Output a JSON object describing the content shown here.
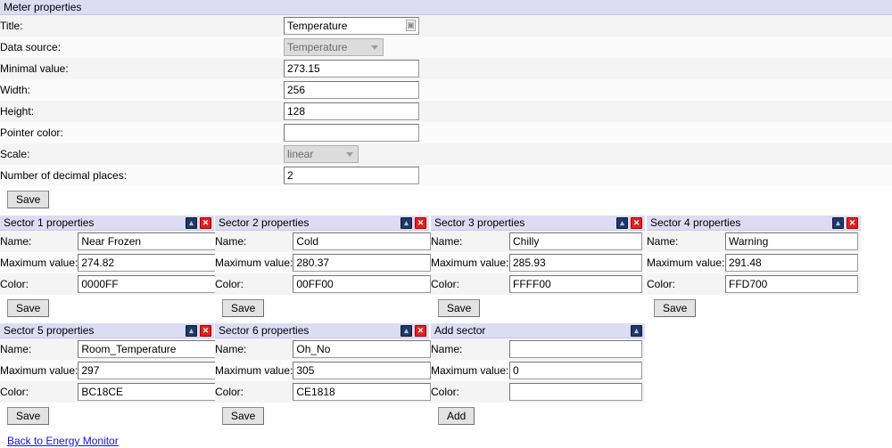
{
  "meter": {
    "header": "Meter properties",
    "rows": [
      {
        "label": "Title:",
        "value": "Temperature",
        "kind": "text-spell"
      },
      {
        "label": "Data source:",
        "value": "Temperature",
        "kind": "select"
      },
      {
        "label": "Minimal value:",
        "value": "273.15",
        "kind": "text"
      },
      {
        "label": "Width:",
        "value": "256",
        "kind": "text"
      },
      {
        "label": "Height:",
        "value": "128",
        "kind": "text"
      },
      {
        "label": "Pointer color:",
        "value": "",
        "kind": "text"
      },
      {
        "label": "Scale:",
        "value": "linear",
        "kind": "select"
      },
      {
        "label": "Number of decimal places:",
        "value": "2",
        "kind": "text"
      }
    ],
    "save_label": "Save"
  },
  "field_labels": {
    "name": "Name:",
    "maximum_value": "Maximum value:",
    "color": "Color:"
  },
  "icons": {
    "collapse": "collapse-icon",
    "collapse_glyph": "▴",
    "close": "close-icon",
    "close_glyph": "✕",
    "spellcheck_glyph": "▣",
    "dropdown": "chevron-down-icon"
  },
  "sectors": [
    {
      "header": "Sector 1 properties",
      "name": "Near Frozen",
      "maximum_value": "274.82",
      "color": "0000FF",
      "save_label": "Save"
    },
    {
      "header": "Sector 2 properties",
      "name": "Cold",
      "maximum_value": "280.37",
      "color": "00FF00",
      "save_label": "Save"
    },
    {
      "header": "Sector 3 properties",
      "name": "Chilly",
      "maximum_value": "285.93",
      "color": "FFFF00",
      "save_label": "Save"
    },
    {
      "header": "Sector 4 properties",
      "name": "Warning",
      "maximum_value": "291.48",
      "color": "FFD700",
      "save_label": "Save"
    },
    {
      "header": "Sector 5 properties",
      "name": "Room_Temperature",
      "maximum_value": "297",
      "color": "BC18CE",
      "save_label": "Save"
    },
    {
      "header": "Sector 6 properties",
      "name": "Oh_No",
      "maximum_value": "305",
      "color": "CE1818",
      "save_label": "Save"
    }
  ],
  "add_sector": {
    "header": "Add sector",
    "name": "",
    "maximum_value": "0",
    "color": "",
    "add_label": "Add"
  },
  "footer": {
    "back_link": "Back to Energy Monitor"
  },
  "colors": {
    "panel_header_bg": "#dcdcf5",
    "row_odd_bg": "#f4f4f4",
    "row_even_bg": "#fbfbfb",
    "link": "#1414d2",
    "close_icon": "#e02020",
    "collapse_icon": "#1f3864"
  }
}
